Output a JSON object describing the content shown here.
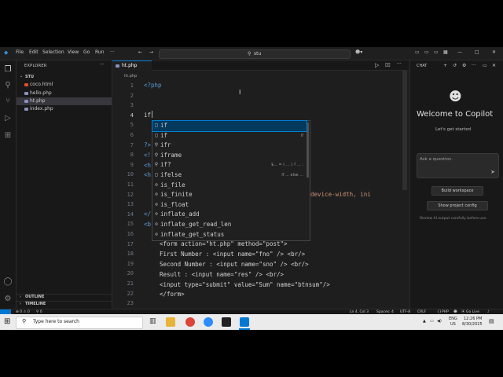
{
  "window": {
    "menu": [
      "File",
      "Edit",
      "Selection",
      "View",
      "Go",
      "Run"
    ],
    "search_text": "stu"
  },
  "sidebar": {
    "title": "EXPLORER",
    "folder": "STU",
    "files": [
      {
        "name": "coco.html",
        "color": "#e44d26"
      },
      {
        "name": "hello.php",
        "color": "#8892bf"
      },
      {
        "name": "ht.php",
        "color": "#8892bf",
        "selected": true
      },
      {
        "name": "index.php",
        "color": "#8892bf"
      }
    ],
    "outline": "OUTLINE",
    "timeline": "TIMELINE"
  },
  "editor": {
    "tab": "ht.php",
    "breadcrumb": "ht.php",
    "line_numbers": [
      "1",
      "2",
      "3",
      "4",
      "5",
      "6",
      "7",
      "8",
      "9",
      "10",
      "11",
      "12",
      "13",
      "14",
      "15",
      "16",
      "17",
      "18",
      "19",
      "20",
      "21",
      "22",
      "23"
    ],
    "lines": {
      "l1": "<?php",
      "l4": "if",
      "l7": "?>",
      "l8": "<!",
      "l9": "<h",
      "l10": "<h",
      "l11_tail": "device-width, ini",
      "l13": "</",
      "l14": "<b",
      "l17": "<form action=\"ht.php\" method=\"post\">",
      "l18": "First Number : <input name=\"fno\" /> <br/>",
      "l19": "Second Number : <input name=\"sno\" /> <br/>",
      "l20": "Result : <input name=\"res\" /> <br/>",
      "l21": "<input type=\"submit\" value=\"Sum\" name=\"btnsum\"/>",
      "l22": "</form>"
    },
    "suggestions": [
      {
        "label": "if",
        "icon": "□",
        "detail": ""
      },
      {
        "label": "if",
        "icon": "□",
        "detail": "if"
      },
      {
        "label": "ifr",
        "icon": "⚲",
        "detail": ""
      },
      {
        "label": "iframe",
        "icon": "⚲",
        "detail": ""
      },
      {
        "label": "if?",
        "icon": "⚲",
        "detail": "$... = ( ... ) ? ... :"
      },
      {
        "label": "ifelse",
        "icon": "□",
        "detail": "if ... else ..."
      },
      {
        "label": "is_file",
        "icon": "⊙",
        "detail": ""
      },
      {
        "label": "is_finite",
        "icon": "⊙",
        "detail": ""
      },
      {
        "label": "is_float",
        "icon": "⊙",
        "detail": ""
      },
      {
        "label": "inflate_add",
        "icon": "⊙",
        "detail": ""
      },
      {
        "label": "inflate_get_read_len",
        "icon": "⊙",
        "detail": ""
      },
      {
        "label": "inflate_get_status",
        "icon": "⊙",
        "detail": ""
      }
    ]
  },
  "chat": {
    "tab": "CHAT",
    "welcome": "Welcome to Copilot",
    "subtitle": "Let's get started",
    "placeholder": "Ask a question.",
    "build_button": "Build workspace",
    "config_button": "Show project config",
    "disclaimer": "Review AI output carefully before use."
  },
  "statusbar": {
    "errors": "⊗ 0 ⚠ 0",
    "warnings": "⚲ 0",
    "position": "Ln 4, Col 3",
    "spaces": "Spaces: 4",
    "encoding": "UTF-8",
    "eol": "CRLF",
    "language": "PHP",
    "golive": "Go Live"
  },
  "taskbar": {
    "search_placeholder": "Type here to search",
    "lang": "ENG",
    "region": "US",
    "time": "12:26 PM",
    "date": "8/30/2025"
  }
}
